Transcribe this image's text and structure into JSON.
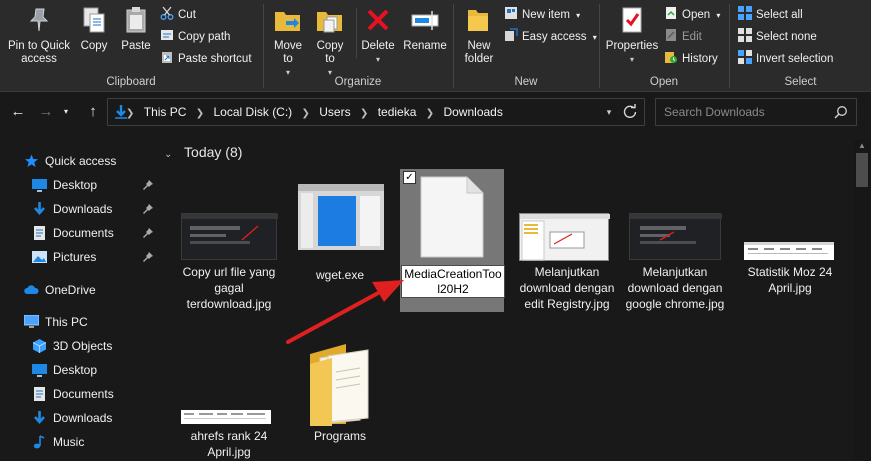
{
  "ribbon": {
    "clipboard": {
      "label": "Clipboard",
      "pin": "Pin to Quick access",
      "copy": "Copy",
      "paste": "Paste",
      "cut": "Cut",
      "copy_path": "Copy path",
      "paste_shortcut": "Paste shortcut"
    },
    "organize": {
      "label": "Organize",
      "move_to": "Move to",
      "copy_to": "Copy to",
      "delete": "Delete",
      "rename": "Rename"
    },
    "new": {
      "label": "New",
      "new_folder": "New folder",
      "new_item": "New item",
      "easy_access": "Easy access"
    },
    "open": {
      "label": "Open",
      "properties": "Properties",
      "open": "Open",
      "edit": "Edit",
      "history": "History"
    },
    "select": {
      "label": "Select",
      "select_all": "Select all",
      "select_none": "Select none",
      "invert": "Invert selection"
    }
  },
  "address": {
    "crumbs": [
      "This PC",
      "Local Disk (C:)",
      "Users",
      "tedieka",
      "Downloads"
    ]
  },
  "search": {
    "placeholder": "Search Downloads"
  },
  "nav": {
    "quick_access": "Quick access",
    "desktop": "Desktop",
    "downloads": "Downloads",
    "documents": "Documents",
    "pictures": "Pictures",
    "onedrive": "OneDrive",
    "this_pc": "This PC",
    "objects3d": "3D Objects",
    "pc_desktop": "Desktop",
    "pc_documents": "Documents",
    "pc_downloads": "Downloads",
    "music": "Music"
  },
  "content": {
    "group": "Today (8)",
    "files": [
      {
        "name": "Copy url file yang gagal terdownload.jpg"
      },
      {
        "name": "wget.exe"
      },
      {
        "name": "MediaCreationToo l20H2"
      },
      {
        "name": "Melanjutkan download dengan edit Registry.jpg"
      },
      {
        "name": "Melanjutkan download dengan google chrome.jpg"
      },
      {
        "name": "Statistik Moz 24 April.jpg"
      },
      {
        "name": "ahrefs rank 24 April.jpg"
      },
      {
        "name": "Programs"
      }
    ],
    "rename_value": "MediaCreationToo l20H2"
  },
  "colors": {
    "background": "#191919",
    "ribbon": "#2b2b2b",
    "accent_blue": "#0f7bd8",
    "folder_yellow": "#e8b93a",
    "delete_red": "#e81123",
    "annotation_red": "#e0201e"
  }
}
